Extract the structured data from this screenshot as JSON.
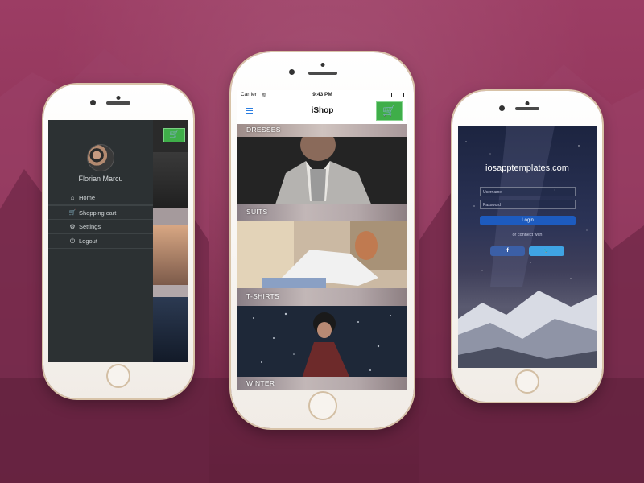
{
  "left_phone": {
    "user_name": "Florian Marcu",
    "menu": [
      {
        "label": "Home",
        "icon": "home-icon",
        "glyph": "⌂"
      },
      {
        "label": "Shopping cart",
        "icon": "cart-icon",
        "glyph": "🛒"
      },
      {
        "label": "Settings",
        "icon": "gear-icon",
        "glyph": "⚙"
      },
      {
        "label": "Logout",
        "icon": "power-icon",
        "glyph": "⏻"
      }
    ]
  },
  "middle_phone": {
    "status": {
      "carrier": "Carrier",
      "time": "9:43 PM"
    },
    "title": "iShop",
    "categories": [
      "DRESSES",
      "SUITS",
      "T-SHIRTS",
      "WINTER"
    ]
  },
  "right_phone": {
    "site": "iosapptemplates.com",
    "username_placeholder": "Username",
    "password_placeholder": "Password",
    "login_label": "Login",
    "connect_text": "or connect with",
    "facebook": "f",
    "twitter": "🐦"
  },
  "colors": {
    "accent_green": "#3fae49",
    "login_blue": "#1d5bbf",
    "background": "#8e3459"
  }
}
